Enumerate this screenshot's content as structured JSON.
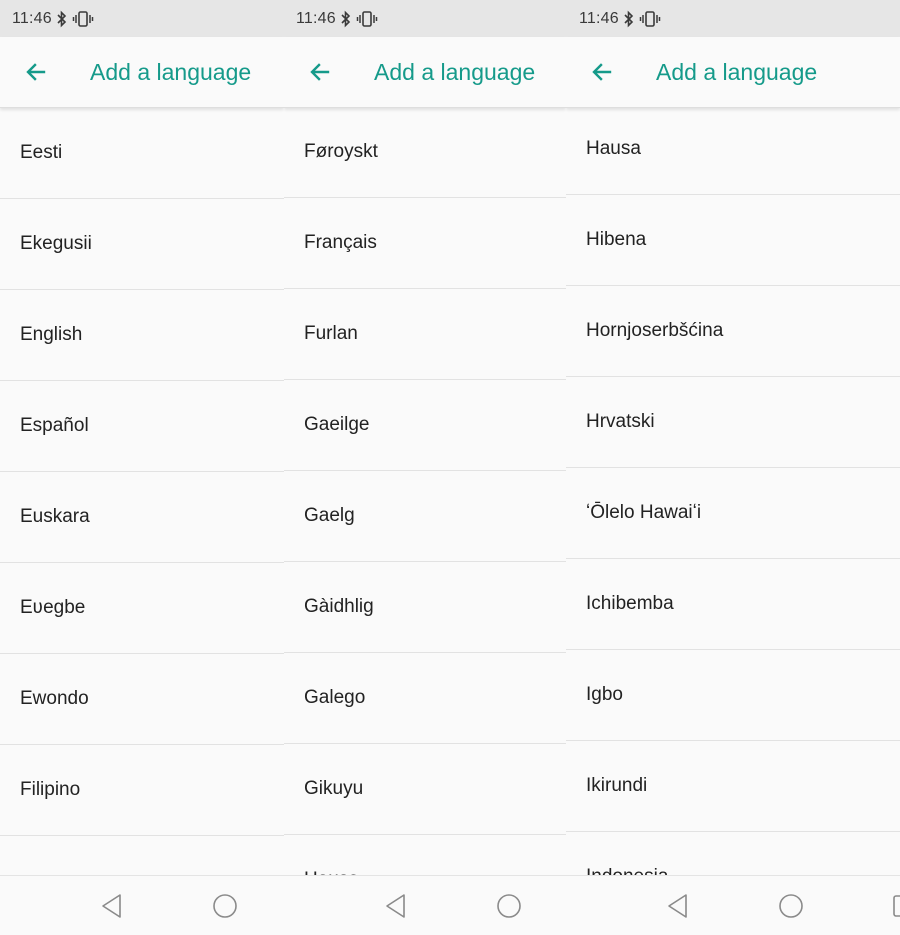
{
  "status_bar": {
    "time": "11:46"
  },
  "header": {
    "title": "Add a language"
  },
  "panels": [
    {
      "items": [
        "Eesti",
        "Ekegusii",
        "English",
        "Español",
        "Euskara",
        "Eʋegbe",
        "Ewondo",
        "Filipino",
        ""
      ]
    },
    {
      "items": [
        "Føroyskt",
        "Français",
        "Furlan",
        "Gaeilge",
        "Gaelg",
        "Gàidhlig",
        "Galego",
        "Gikuyu",
        "Hausa"
      ]
    },
    {
      "items": [
        "Hausa",
        "Hibena",
        "Hornjoserbšćina",
        "Hrvatski",
        "ʻŌlelo Hawaiʻi",
        "Ichibemba",
        "Igbo",
        "Ikirundi",
        "Indonesia"
      ]
    }
  ],
  "colors": {
    "accent": "#159a8a",
    "text": "#222222",
    "status_bg": "#e6e6e6",
    "background": "#fafafa"
  },
  "icons": {
    "back": "arrow-left-icon",
    "bluetooth": "bluetooth-icon",
    "vibrate": "vibrate-icon",
    "nav_back": "triangle-back-icon",
    "nav_home": "circle-home-icon",
    "nav_recent": "square-recent-icon"
  }
}
